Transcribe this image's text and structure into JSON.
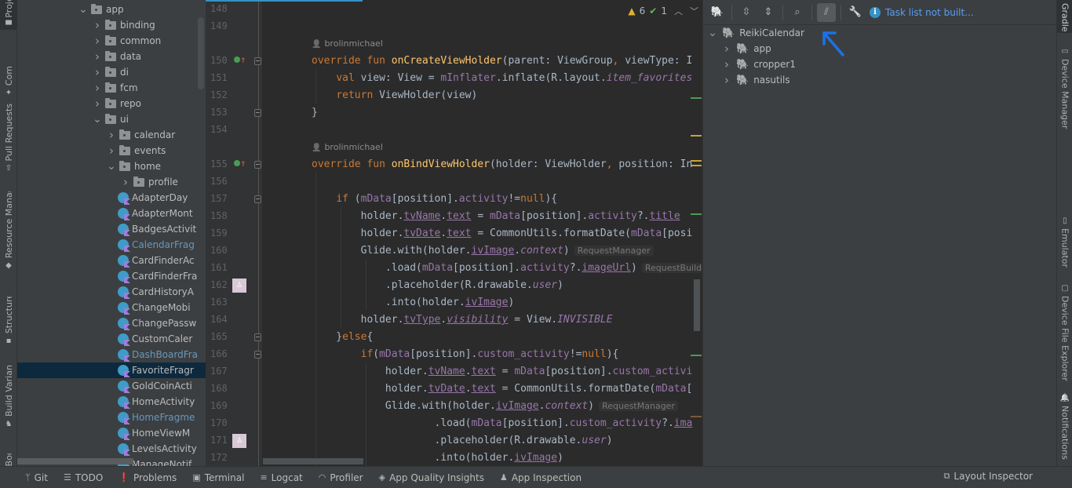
{
  "left_stripe": [
    {
      "label": "Project",
      "icon": "folder-icon"
    },
    {
      "label": "Commit",
      "icon": "commit-icon"
    },
    {
      "label": "Pull Requests",
      "icon": "pull-request-icon"
    },
    {
      "label": "Resource Manager",
      "icon": "resource-manager-icon"
    },
    {
      "label": "Structure",
      "icon": "structure-icon"
    },
    {
      "label": "Build Variants",
      "icon": "android-icon"
    },
    {
      "label": "Bookmarks",
      "icon": "bookmark-icon"
    }
  ],
  "project_tree": [
    {
      "label": "app",
      "type": "folder",
      "expanded": true,
      "depth": 0
    },
    {
      "label": "binding",
      "type": "folder",
      "expanded": false,
      "depth": 1
    },
    {
      "label": "common",
      "type": "folder",
      "expanded": false,
      "depth": 1
    },
    {
      "label": "data",
      "type": "folder",
      "expanded": false,
      "depth": 1
    },
    {
      "label": "di",
      "type": "folder",
      "expanded": false,
      "depth": 1
    },
    {
      "label": "fcm",
      "type": "folder",
      "expanded": false,
      "depth": 1
    },
    {
      "label": "repo",
      "type": "folder",
      "expanded": false,
      "depth": 1
    },
    {
      "label": "ui",
      "type": "folder",
      "expanded": true,
      "depth": 1
    },
    {
      "label": "calendar",
      "type": "folder",
      "expanded": false,
      "depth": 2
    },
    {
      "label": "events",
      "type": "folder",
      "expanded": false,
      "depth": 2
    },
    {
      "label": "home",
      "type": "folder",
      "expanded": true,
      "depth": 2
    },
    {
      "label": "profile",
      "type": "folder",
      "expanded": false,
      "depth": 3
    },
    {
      "label": "AdapterDay",
      "type": "kotlin",
      "depth": 3
    },
    {
      "label": "AdapterMont",
      "type": "kotlin",
      "depth": 3
    },
    {
      "label": "BadgesActivit",
      "type": "kotlin",
      "depth": 3
    },
    {
      "label": "CalendarFrag",
      "type": "kotlin",
      "depth": 3,
      "modified": true
    },
    {
      "label": "CardFinderAc",
      "type": "kotlin",
      "depth": 3
    },
    {
      "label": "CardFinderFra",
      "type": "kotlin",
      "depth": 3
    },
    {
      "label": "CardHistoryA",
      "type": "kotlin",
      "depth": 3
    },
    {
      "label": "ChangeMobi",
      "type": "kotlin",
      "depth": 3
    },
    {
      "label": "ChangePassw",
      "type": "kotlin",
      "depth": 3
    },
    {
      "label": "CustomCaler",
      "type": "kotlin",
      "depth": 3
    },
    {
      "label": "DashBoardFra",
      "type": "kotlin",
      "depth": 3,
      "modified": true
    },
    {
      "label": "FavoriteFragr",
      "type": "kotlin",
      "depth": 3,
      "selected": true
    },
    {
      "label": "GoldCoinActi",
      "type": "kotlin",
      "depth": 3
    },
    {
      "label": "HomeActivity",
      "type": "kotlin",
      "depth": 3
    },
    {
      "label": "HomeFragme",
      "type": "kotlin",
      "depth": 3,
      "modified": true
    },
    {
      "label": "HomeViewM",
      "type": "kotlin",
      "depth": 3
    },
    {
      "label": "LevelsActivity",
      "type": "kotlin",
      "depth": 3
    },
    {
      "label": "ManageNotif",
      "type": "kotlin",
      "depth": 3
    }
  ],
  "editor": {
    "inspections": {
      "warnings": "6",
      "typos": "1"
    },
    "authors": [
      {
        "text": "brolinmichael",
        "before_line": 150
      },
      {
        "text": "brolinmichael",
        "before_line": 155
      }
    ],
    "lines": [
      {
        "n": "148",
        "html": ""
      },
      {
        "n": "149",
        "html": ""
      },
      {
        "n": "150",
        "html": "<span class='kw'>override fun </span><span class='fn'>onCreateViewHolder</span>(parent: ViewGroup<span class='kw'>, </span>viewType: I",
        "impl": true,
        "fold": true
      },
      {
        "n": "151",
        "html": "    <span class='kw'>val </span>view: View = <span class='prop'>mInflater</span>.inflate(R.layout.<span class='prop it'>item_favorites</span>"
      },
      {
        "n": "152",
        "html": "    <span class='kw'>return </span>ViewHolder(view)"
      },
      {
        "n": "153",
        "html": "}",
        "fold": true
      },
      {
        "n": "154",
        "html": ""
      },
      {
        "n": "155",
        "html": "<span class='kw'>override fun </span><span class='fn'>onBindViewHolder</span>(holder: ViewHolder<span class='kw'>, </span>position: In",
        "impl": true,
        "fold": true
      },
      {
        "n": "156",
        "html": ""
      },
      {
        "n": "157",
        "html": "    <span class='kw'>if </span>(<span class='prop'>mData</span>[position].<span class='prop'>activity</span>!=<span class='kw'>null</span>){",
        "fold": true
      },
      {
        "n": "158",
        "html": "        holder.<span class='prop und'>tvName</span>.<span class='prop und'>text</span> = <span class='prop'>mData</span>[position].<span class='prop'>activity</span>?.<span class='prop und'>title</span>"
      },
      {
        "n": "159",
        "html": "        holder.<span class='prop und'>tvDate</span>.<span class='prop und'>text</span> = CommonUtils.formatDate(<span class='prop'>mData</span>[posi"
      },
      {
        "n": "160",
        "html": "        Glide.with(holder.<span class='prop und'>ivImage</span>.<span class='prop it'>context</span>)<span class='hint'>RequestManager</span>"
      },
      {
        "n": "161",
        "html": "            .load(<span class='prop'>mData</span>[position].<span class='prop'>activity</span>?.<span class='prop und'>imageUrl</span>)<span class='hint'>RequestBuild</span>"
      },
      {
        "n": "162",
        "html": "            .placeholder(R.drawable.<span class='prop it'>user</span>)",
        "blame": true
      },
      {
        "n": "163",
        "html": "            .into(holder.<span class='prop und'>ivImage</span>)"
      },
      {
        "n": "164",
        "html": "        holder.<span class='prop und'>tvType</span>.<span class='prop it und'>visibility</span> = View.<span class='prop it'>INVISIBLE</span>"
      },
      {
        "n": "165",
        "html": "    }<span class='kw'>else</span>{",
        "fold": true
      },
      {
        "n": "166",
        "html": "        <span class='kw'>if</span>(<span class='prop'>mData</span>[position].<span class='prop'>custom_activity</span>!=<span class='kw'>null</span>){",
        "fold": true
      },
      {
        "n": "167",
        "html": "            holder.<span class='prop und'>tvName</span>.<span class='prop und'>text</span> = <span class='prop'>mData</span>[position].<span class='prop'>custom_activi</span>"
      },
      {
        "n": "168",
        "html": "            holder.<span class='prop und'>tvDate</span>.<span class='prop und'>text</span> = CommonUtils.formatDate(<span class='prop'>mData</span>["
      },
      {
        "n": "169",
        "html": "            Glide.with(holder.<span class='prop und'>ivImage</span>.<span class='prop it'>context</span>)<span class='hint'>RequestManager</span>"
      },
      {
        "n": "170",
        "html": "                    .load(<span class='prop'>mData</span>[position].<span class='prop'>custom_activity</span>?.<span class='prop und'>ima</span>"
      },
      {
        "n": "171",
        "html": "                    .placeholder(R.drawable.<span class='prop it'>user</span>)",
        "blame": true
      },
      {
        "n": "172",
        "html": "                    .into(holder.<span class='prop und'>ivImage</span>)"
      }
    ]
  },
  "gradle": {
    "toolbar": [
      {
        "name": "gradle-elephant-button",
        "glyph": "🐘"
      },
      {
        "name": "expand-all-button",
        "glyph": "⇳"
      },
      {
        "name": "collapse-all-button",
        "glyph": "⇕"
      },
      {
        "name": "analyze-button",
        "glyph": "⌕"
      },
      {
        "name": "toggle-offline-mode-button",
        "glyph": "⫽",
        "active": true
      },
      {
        "name": "build-settings-button",
        "glyph": "🔧"
      }
    ],
    "task_info": "Task list not built...",
    "tree": [
      {
        "label": "ReikiCalendar",
        "expanded": true,
        "depth": 0
      },
      {
        "label": "app",
        "expanded": false,
        "depth": 1
      },
      {
        "label": "cropper1",
        "expanded": false,
        "depth": 1
      },
      {
        "label": "nasutils",
        "expanded": false,
        "depth": 1
      }
    ]
  },
  "right_stripe": [
    {
      "label": "Gradle",
      "icon": "",
      "active": true
    },
    {
      "label": "Device Manager",
      "icon": "device-manager-icon"
    },
    {
      "label": "Emulator",
      "icon": "emulator-icon"
    },
    {
      "label": "Device File Explorer",
      "icon": "device-file-explorer-icon"
    },
    {
      "label": "Notifications",
      "icon": "notifications-icon"
    }
  ],
  "bottom_bar": {
    "items": [
      {
        "label": "Git",
        "icon": "git-branch-icon",
        "glyph": "ᛘ"
      },
      {
        "label": "TODO",
        "icon": "todo-list-icon",
        "glyph": "☰"
      },
      {
        "label": "Problems",
        "icon": "problems-icon",
        "glyph": "❗"
      },
      {
        "label": "Terminal",
        "icon": "terminal-icon",
        "glyph": "▣"
      },
      {
        "label": "Logcat",
        "icon": "logcat-icon",
        "glyph": "≡"
      },
      {
        "label": "Profiler",
        "icon": "profiler-icon",
        "glyph": "◠"
      },
      {
        "label": "App Quality Insights",
        "icon": "app-quality-insights-icon",
        "glyph": "◈"
      },
      {
        "label": "App Inspection",
        "icon": "app-inspection-icon",
        "glyph": "♟"
      }
    ],
    "right": {
      "label": "Layout Inspector",
      "icon": "layout-inspector-icon",
      "glyph": "⧉"
    }
  },
  "colors": {
    "accent": "#3592c4",
    "link": "#589df6",
    "selection": "#0d293e",
    "annotation_arrow": "#1a73e8"
  }
}
